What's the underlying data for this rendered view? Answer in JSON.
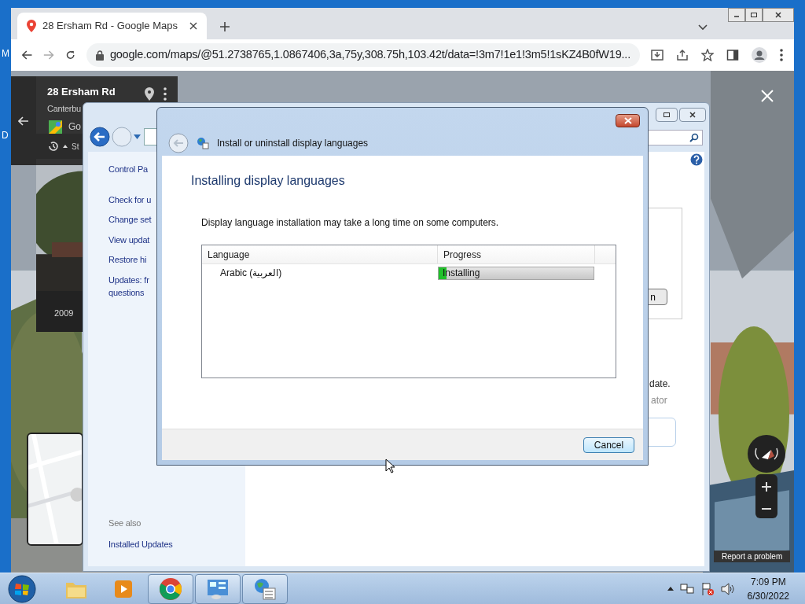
{
  "desktop": {
    "icon_labels": [
      "M",
      "D"
    ]
  },
  "browser": {
    "tabs": [
      {
        "title": "28 Ersham Rd - Google Maps",
        "selected": true
      }
    ],
    "url": "google.com/maps/@51.2738765,1.0867406,3a,75y,308.75h,103.42t/data=!3m7!1e1!3m5!1sKZ4B0fW19...",
    "place_card": {
      "title": "28 Ersham Rd",
      "subtitle": "Canterbu",
      "link": "Go",
      "menu": "St",
      "year": "2009"
    },
    "report_link": "Report a problem"
  },
  "control_panel": {
    "sidebar": [
      "Control Pa",
      "Check for u",
      "Change set",
      "View updat",
      "Restore hi",
      "Updates: fr\nquestions"
    ],
    "see_also_heading": "See also",
    "see_also": [
      "Installed Updates"
    ],
    "content_button": "n",
    "content_text": "date.",
    "content_note": "ator"
  },
  "dialog": {
    "title": "Install or uninstall display languages",
    "heading": "Installing display languages",
    "description": "Display language installation may take a long time on some computers.",
    "columns": [
      "Language",
      "Progress"
    ],
    "rows": [
      {
        "language": "Arabic (العربية)",
        "status": "Installing",
        "level": 0.05
      }
    ],
    "cancel": "Cancel"
  },
  "taskbar": {
    "apps": [
      {
        "kind": "folder",
        "running": false
      },
      {
        "kind": "media",
        "running": false
      },
      {
        "kind": "chrome",
        "running": true
      },
      {
        "kind": "control",
        "running": true
      },
      {
        "kind": "language",
        "running": true
      }
    ],
    "time": "7:09 PM",
    "date": "6/30/2022"
  }
}
